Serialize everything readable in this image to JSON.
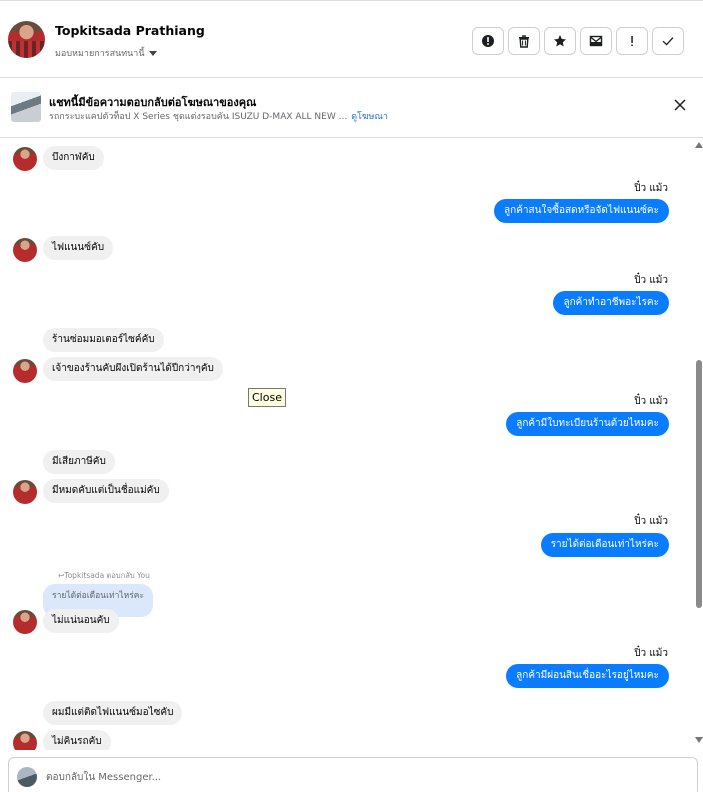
{
  "header": {
    "contact_name": "Topkitsada Prathiang",
    "assign_label": "มอบหมายการสนทนานี้",
    "actions": [
      {
        "icon": "alert-circle-icon"
      },
      {
        "icon": "trash-icon"
      },
      {
        "icon": "star-icon"
      },
      {
        "icon": "mail-unread-icon"
      },
      {
        "icon": "exclamation-icon"
      },
      {
        "icon": "check-icon"
      }
    ]
  },
  "ad_banner": {
    "title": "แชทนี้มีข้อความตอบกลับต่อโฆษณาของคุณ",
    "subtitle": "รถกระบะแคปตัวท็อป X Series ชุดแต่งรอบคัน ISUZU D-MAX ALL NEW ...",
    "link_label": "ดูโฆษณา"
  },
  "messages": {
    "m1": "บึงกาฬคับ",
    "s1": "ปิ๋ว แม้ว",
    "o1": "ลูกค้าสนใจซื้อสดหรือจัดไฟแนนซ์คะ",
    "m2": "ไฟแนนซ์คับ",
    "s2": "ปิ๋ว แม้ว",
    "o2": "ลูกค้าทำอาชีพอะไรคะ",
    "m3": "ร้านซ่อมมอเตอร์ไซค์คับ",
    "m4": "เจ้าของร้านคับผึงเปิดร้านได้ปีกว่าๆคับ",
    "s3": "ปิ๋ว แม้ว",
    "o3": "ลูกค้ามีใบทะเบียนร้านด้วยไหมคะ",
    "m5": "มีเสียภาษีคับ",
    "m6": "มีหมดคับแต่เป็นชื่อแม่คับ",
    "s4": "ปิ๋ว แม้ว",
    "o4": "รายได้ต่อเดือนเท่าไหร่คะ",
    "reply_note": "↩Topkitsada ตอบกลับ You",
    "reply_quote": "รายได้ต่อเดือนเท่าไหร่คะ",
    "m7": "ไม่แน่นอนคับ",
    "s5": "ปิ๋ว แม้ว",
    "o5": "ลูกค้ามีผ่อนสินเชื่ออะไรอยู่ไหมคะ",
    "m8": "ผมมีแต่ติดไฟแนนซ์มอไซคับ",
    "m9": "ไม่คินรถคับ"
  },
  "tooltip": "Close",
  "composer": {
    "placeholder": "ตอบกลับใน Messenger..."
  }
}
